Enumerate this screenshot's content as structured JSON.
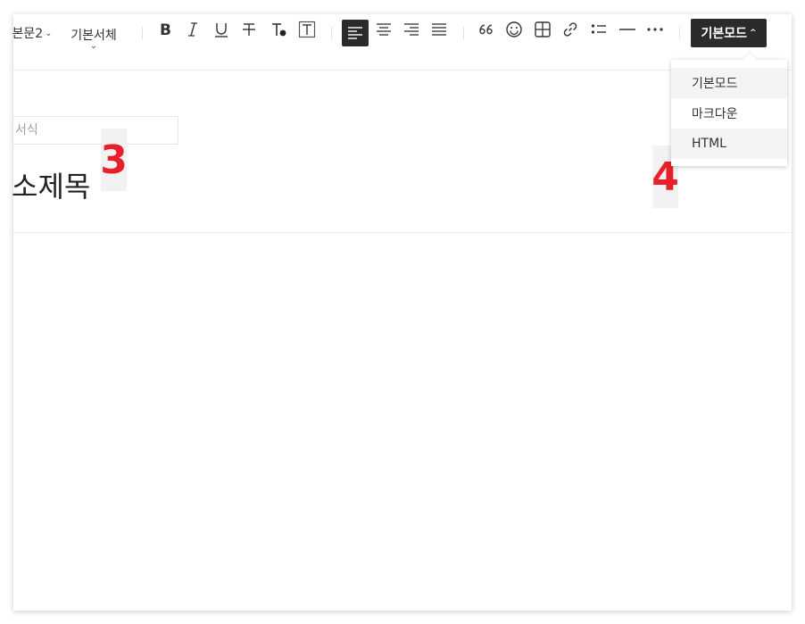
{
  "toolbar": {
    "paragraph_style": "본문2",
    "font_family": "기본서체",
    "icons": {
      "bold": "bold-icon",
      "italic": "italic-icon",
      "underline": "underline-icon",
      "strikethrough": "strikethrough-icon",
      "text_color": "text-color-icon",
      "text_background": "text-background-icon",
      "align_left": "align-left-icon",
      "align_center": "align-center-icon",
      "align_right": "align-right-icon",
      "align_justify": "align-justify-icon",
      "quote": "quote-icon",
      "emoji": "emoji-icon",
      "table": "table-icon",
      "link": "link-icon",
      "list": "list-icon",
      "horizontal_rule": "horizontal-rule-icon",
      "more": "more-icon"
    },
    "mode_button_label": "기본모드"
  },
  "mode_dropdown": {
    "options": [
      "기본모드",
      "마크다운",
      "HTML"
    ],
    "highlighted": [
      "기본모드",
      "HTML"
    ]
  },
  "editor": {
    "format_placeholder": "서식",
    "heading_text": "소제목"
  },
  "annotations": {
    "marker_3": "3",
    "marker_4": "4",
    "marker_color": "#e8202a"
  },
  "colors": {
    "toolbar_active_bg": "#2b2b2b",
    "border": "#ececec"
  }
}
